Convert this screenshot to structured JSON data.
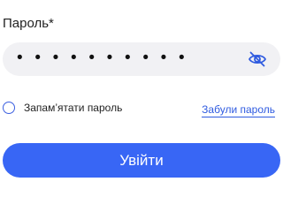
{
  "password_section": {
    "label": "Пароль*",
    "value_masked": "• • • • • • • • • •",
    "visibility_icon": "eye-off-icon"
  },
  "remember_me": {
    "label": "Запам’ятати пароль",
    "checked": false
  },
  "forgot_password": {
    "label": "Забули пароль"
  },
  "login_button": {
    "label": "Увійти"
  },
  "colors": {
    "accent": "#3866f5",
    "link": "#2f5be0",
    "field_bg": "#f1f1f4"
  }
}
